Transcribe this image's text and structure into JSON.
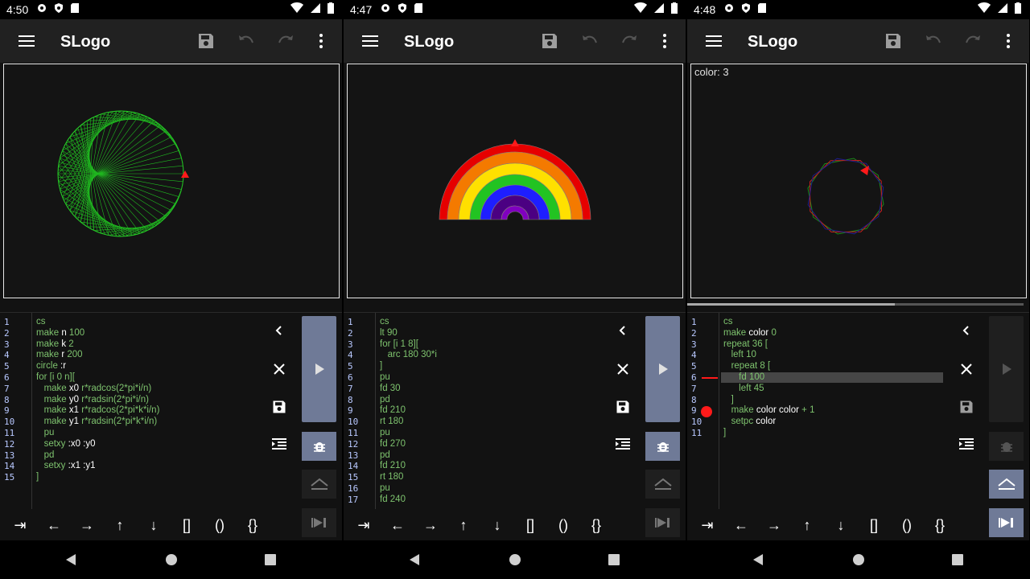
{
  "phones": [
    {
      "time": "4:50",
      "title": "SLogo",
      "canvas_status": "",
      "gutter": [
        "1",
        "2",
        "3",
        "4",
        "5",
        "6",
        "7",
        "8",
        "9",
        "10",
        "11",
        "12",
        "13",
        "14",
        "15"
      ],
      "code": [
        [
          {
            "t": "cs",
            "c": "kw"
          }
        ],
        [
          {
            "t": "make ",
            "c": "kw"
          },
          {
            "t": "n ",
            "c": "nm"
          },
          {
            "t": "100",
            "c": "num"
          }
        ],
        [
          {
            "t": "make ",
            "c": "kw"
          },
          {
            "t": "k ",
            "c": "nm"
          },
          {
            "t": "2",
            "c": "num"
          }
        ],
        [
          {
            "t": "make ",
            "c": "kw"
          },
          {
            "t": "r ",
            "c": "nm"
          },
          {
            "t": "200",
            "c": "num"
          }
        ],
        [
          {
            "t": "circle ",
            "c": "kw"
          },
          {
            "t": ":r",
            "c": "nm"
          }
        ],
        [
          {
            "t": "for ",
            "c": "kw"
          },
          {
            "t": "[i 0 n][",
            "c": "kw"
          }
        ],
        [
          {
            "t": "   make ",
            "c": "kw"
          },
          {
            "t": "x0 ",
            "c": "nm"
          },
          {
            "t": "r*radcos(2*pi*i/n)",
            "c": "kw"
          }
        ],
        [
          {
            "t": "   make ",
            "c": "kw"
          },
          {
            "t": "y0 ",
            "c": "nm"
          },
          {
            "t": "r*radsin(2*pi*i/n)",
            "c": "kw"
          }
        ],
        [
          {
            "t": "   make ",
            "c": "kw"
          },
          {
            "t": "x1 ",
            "c": "nm"
          },
          {
            "t": "r*radcos(2*pi*k*i/n)",
            "c": "kw"
          }
        ],
        [
          {
            "t": "   make ",
            "c": "kw"
          },
          {
            "t": "y1 ",
            "c": "nm"
          },
          {
            "t": "r*radsin(2*pi*k*i/n)",
            "c": "kw"
          }
        ],
        [
          {
            "t": "   pu",
            "c": "kw"
          }
        ],
        [
          {
            "t": "   setxy ",
            "c": "kw"
          },
          {
            "t": ":x0 :y0",
            "c": "nm"
          }
        ],
        [
          {
            "t": "   pd",
            "c": "kw"
          }
        ],
        [
          {
            "t": "   setxy ",
            "c": "kw"
          },
          {
            "t": ":x1 :y1",
            "c": "nm"
          }
        ],
        [
          {
            "t": "]",
            "c": "kw"
          }
        ]
      ]
    },
    {
      "time": "4:47",
      "title": "SLogo",
      "canvas_status": "",
      "gutter": [
        "1",
        "2",
        "3",
        "4",
        "5",
        "6",
        "7",
        "8",
        "9",
        "10",
        "11",
        "12",
        "13",
        "14",
        "15",
        "16",
        "17"
      ],
      "code": [
        [
          {
            "t": "cs",
            "c": "kw"
          }
        ],
        [
          {
            "t": "lt 90",
            "c": "kw"
          }
        ],
        [
          {
            "t": "for ",
            "c": "kw"
          },
          {
            "t": "[i 1 8][",
            "c": "kw"
          }
        ],
        [
          {
            "t": "   arc 180 30*i",
            "c": "kw"
          }
        ],
        [
          {
            "t": "]",
            "c": "kw"
          }
        ],
        [
          {
            "t": "pu",
            "c": "kw"
          }
        ],
        [
          {
            "t": "fd 30",
            "c": "kw"
          }
        ],
        [
          {
            "t": "pd",
            "c": "kw"
          }
        ],
        [
          {
            "t": "fd 210",
            "c": "kw"
          }
        ],
        [
          {
            "t": "rt 180",
            "c": "kw"
          }
        ],
        [
          {
            "t": "pu",
            "c": "kw"
          }
        ],
        [
          {
            "t": "fd 270",
            "c": "kw"
          }
        ],
        [
          {
            "t": "pd",
            "c": "kw"
          }
        ],
        [
          {
            "t": "fd 210",
            "c": "kw"
          }
        ],
        [
          {
            "t": "rt 180",
            "c": "kw"
          }
        ],
        [
          {
            "t": "pu",
            "c": "kw"
          }
        ],
        [
          {
            "t": "fd 240",
            "c": "kw"
          }
        ]
      ]
    },
    {
      "time": "4:48",
      "title": "SLogo",
      "canvas_status": "color: 3",
      "gutter": [
        "1",
        "2",
        "3",
        "4",
        "5",
        "6",
        "7",
        "8",
        "9",
        "10",
        "11"
      ],
      "code": [
        [
          {
            "t": "cs",
            "c": "kw"
          }
        ],
        [
          {
            "t": "make ",
            "c": "kw"
          },
          {
            "t": "color ",
            "c": "nm"
          },
          {
            "t": "0",
            "c": "num"
          }
        ],
        [
          {
            "t": "repeat 36 [",
            "c": "kw"
          }
        ],
        [
          {
            "t": "   left 10",
            "c": "kw"
          }
        ],
        [
          {
            "t": "   repeat 8 [",
            "c": "kw"
          }
        ],
        [
          {
            "t": "      fd 100",
            "c": "kw"
          }
        ],
        [
          {
            "t": "      left 45",
            "c": "kw"
          }
        ],
        [
          {
            "t": "   ]",
            "c": "kw"
          }
        ],
        [
          {
            "t": "   make ",
            "c": "kw"
          },
          {
            "t": "color color ",
            "c": "nm"
          },
          {
            "t": "+ 1",
            "c": "kw"
          }
        ],
        [
          {
            "t": "   setpc ",
            "c": "kw"
          },
          {
            "t": "color",
            "c": "nm"
          }
        ],
        [
          {
            "t": "]",
            "c": "kw"
          }
        ]
      ]
    }
  ],
  "toolbar": {
    "tab": "⇥",
    "left": "←",
    "right": "→",
    "up": "↑",
    "down": "↓",
    "brackets": "[]",
    "parens": "()",
    "braces": "{}"
  },
  "colors": {
    "accent": "#6f7a97",
    "keyword": "#7ec36e",
    "turtle": "#ff1a1a",
    "breakpoint": "#ff1a1a"
  }
}
